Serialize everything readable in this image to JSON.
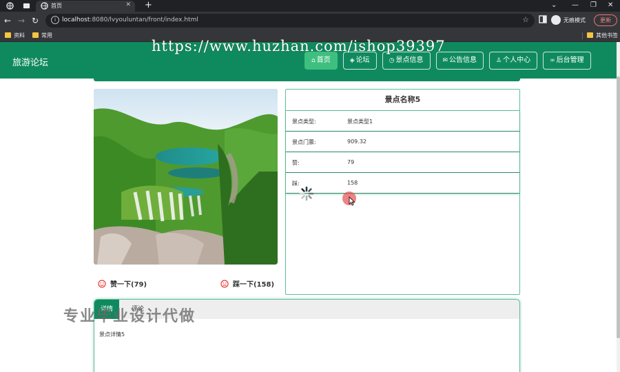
{
  "browser": {
    "tab_title": "首页",
    "url_host": "localhost",
    "url_rest": ":8080/lvyouluntan/front/index.html",
    "incognito_label": "无痕模式",
    "update_label": "更新",
    "bookmarks": [
      "资料",
      "常用"
    ],
    "other_bookmarks": "其他书签"
  },
  "header": {
    "title": "旅游论坛",
    "nav": [
      {
        "label": "首页",
        "icon": "home-icon"
      },
      {
        "label": "论坛",
        "icon": "layers-icon"
      },
      {
        "label": "景点信息",
        "icon": "clock-icon"
      },
      {
        "label": "公告信息",
        "icon": "mail-icon"
      },
      {
        "label": "个人中心",
        "icon": "user-icon"
      },
      {
        "label": "后台管理",
        "icon": "link-icon"
      }
    ]
  },
  "scenic": {
    "name": "景点名称5",
    "rows": [
      {
        "label": "景点类型:",
        "value": "景点类型1"
      },
      {
        "label": "景点门票:",
        "value": "909.32"
      },
      {
        "label": "赞:",
        "value": "79"
      },
      {
        "label": "踩:",
        "value": "158"
      }
    ],
    "like_label": "赞一下(79)",
    "dislike_label": "踩一下(158)"
  },
  "detail": {
    "tabs": [
      "详情",
      "评论"
    ],
    "content": "景点详情5"
  },
  "overlays": {
    "watermark_url": "https://www.huzhan.com/ishop39397",
    "watermark_cn": "专业毕业设计代做"
  },
  "colors": {
    "brand": "#0f8a5f",
    "active_nav": "#3fbf7f",
    "panel_border": "#5cbf9a"
  }
}
